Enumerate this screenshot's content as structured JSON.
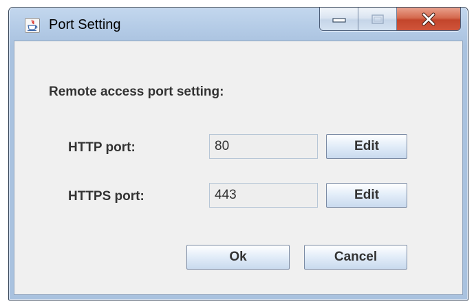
{
  "window": {
    "title": "Port Setting",
    "app_icon": "java-cup-icon"
  },
  "window_controls": {
    "minimize_icon": "minimize-icon",
    "maximize_icon": "maximize-icon",
    "close_icon": "close-icon"
  },
  "content": {
    "heading": "Remote access port setting:",
    "http": {
      "label": "HTTP port:",
      "value": "80",
      "edit_label": "Edit"
    },
    "https": {
      "label": "HTTPS port:",
      "value": "443",
      "edit_label": "Edit"
    },
    "ok_label": "Ok",
    "cancel_label": "Cancel"
  },
  "colors": {
    "frame": "#b4cbe6",
    "close_button": "#c3452b",
    "client_background": "#f0f0f0",
    "text": "#333333"
  }
}
